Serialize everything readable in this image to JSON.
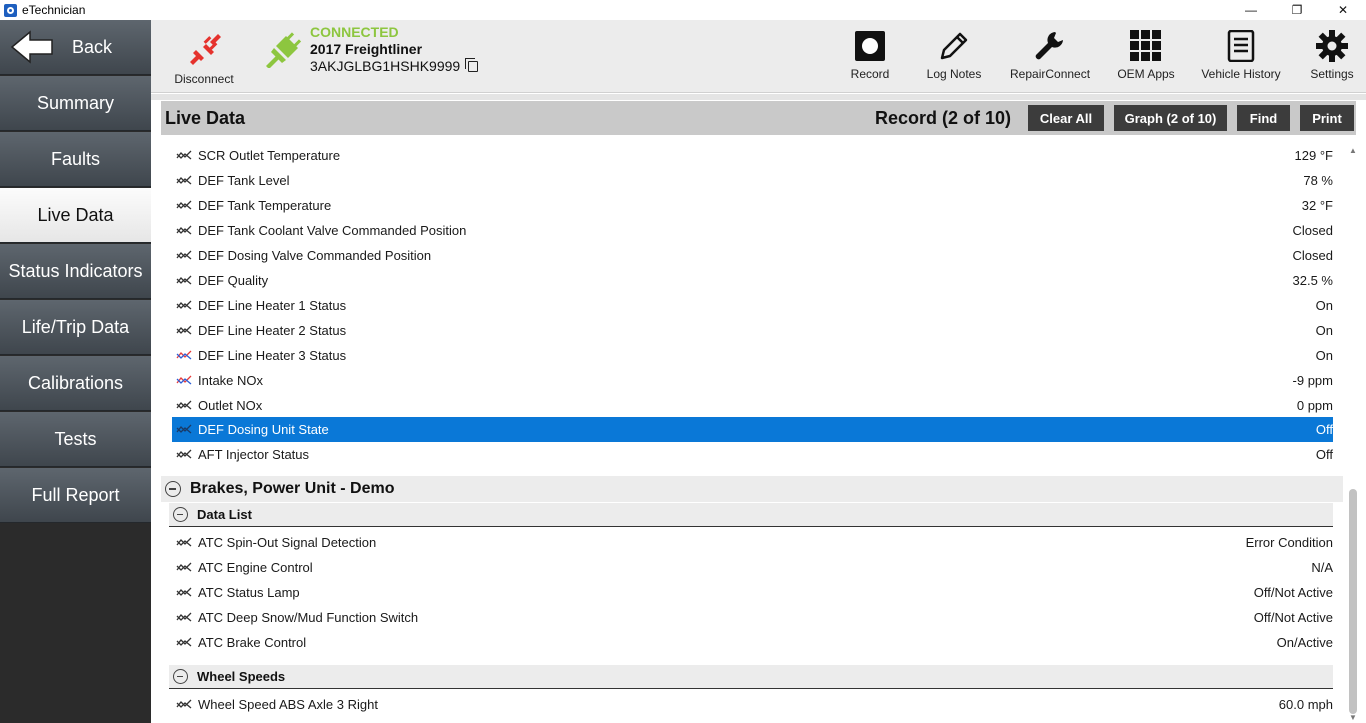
{
  "window": {
    "title": "eTechnician",
    "controls": [
      "—",
      "❐",
      "✕"
    ]
  },
  "sidebar": {
    "back_label": "Back",
    "items": [
      {
        "label": "Summary"
      },
      {
        "label": "Faults"
      },
      {
        "label": "Live Data",
        "active": true
      },
      {
        "label": "Status Indicators"
      },
      {
        "label": "Life/Trip Data"
      },
      {
        "label": "Calibrations"
      },
      {
        "label": "Tests"
      },
      {
        "label": "Full Report"
      }
    ]
  },
  "toolbar": {
    "disconnect_label": "Disconnect",
    "connection_status": "CONNECTED",
    "vehicle": "2017 Freightliner",
    "vin": "3AKJGLBG1HSHK9999",
    "tools": [
      {
        "label": "Record",
        "icon": "record-icon"
      },
      {
        "label": "Log Notes",
        "icon": "pencil-icon"
      },
      {
        "label": "RepairConnect",
        "icon": "wrench-icon"
      },
      {
        "label": "OEM Apps",
        "icon": "grid-icon"
      },
      {
        "label": "Vehicle History",
        "icon": "document-icon"
      },
      {
        "label": "Settings",
        "icon": "gear-icon"
      }
    ]
  },
  "live_data": {
    "title": "Live Data",
    "record_status": "Record (2 of 10)",
    "buttons": {
      "clear_all": "Clear All",
      "graph": "Graph (2 of 10)",
      "find": "Find",
      "print": "Print"
    },
    "rows": [
      {
        "label": "SCR Outlet Temperature",
        "value": "129 °F"
      },
      {
        "label": "DEF Tank Level",
        "value": "78 %"
      },
      {
        "label": "DEF Tank Temperature",
        "value": "32 °F"
      },
      {
        "label": "DEF Tank Coolant Valve Commanded Position",
        "value": "Closed"
      },
      {
        "label": "DEF Dosing Valve Commanded Position",
        "value": "Closed"
      },
      {
        "label": "DEF Quality",
        "value": "32.5 %"
      },
      {
        "label": "DEF Line Heater 1 Status",
        "value": "On"
      },
      {
        "label": "DEF Line Heater 2 Status",
        "value": "On"
      },
      {
        "label": "DEF Line Heater 3 Status",
        "value": "On"
      },
      {
        "label": "Intake NOx",
        "value": "-9 ppm"
      },
      {
        "label": "Outlet NOx",
        "value": "0 ppm"
      },
      {
        "label": "DEF Dosing Unit State",
        "value": "Off"
      },
      {
        "label": "AFT Injector Status",
        "value": "Off"
      }
    ],
    "group": {
      "title": "Brakes, Power Unit - Demo",
      "data_list": {
        "title": "Data List",
        "rows": [
          {
            "label": "ATC Spin-Out Signal Detection",
            "value": "Error Condition"
          },
          {
            "label": "ATC Engine Control",
            "value": "N/A"
          },
          {
            "label": "ATC Status Lamp",
            "value": "Off/Not Active"
          },
          {
            "label": "ATC Deep Snow/Mud Function Switch",
            "value": "Off/Not Active"
          },
          {
            "label": "ATC Brake Control",
            "value": "On/Active"
          }
        ]
      },
      "wheel_speeds": {
        "title": "Wheel Speeds",
        "rows": [
          {
            "label": "Wheel Speed ABS Axle 3 Right",
            "value": "60.0 mph"
          }
        ]
      }
    }
  },
  "colors": {
    "connected": "#8dc63f",
    "selected_row": "#0a78d7",
    "disconnect": "#e5322d",
    "graphed_red": "#e63b3b",
    "graphed_blue": "#2d5fd6"
  }
}
